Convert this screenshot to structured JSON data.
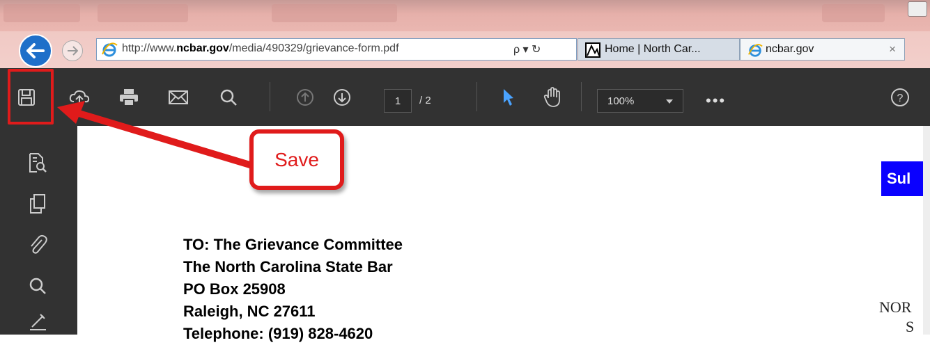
{
  "browser": {
    "url_prefix": "http://www.",
    "url_domain": "ncbar.gov",
    "url_path": "/media/490329/grievance-form.pdf",
    "search_symbol": "ρ ▾ ↻",
    "tabs": [
      {
        "label": "Home | North Car...",
        "icon": "north-carolina-logo-icon",
        "active": false
      },
      {
        "label": "ncbar.gov",
        "icon": "ie-icon",
        "active": true,
        "close": "×"
      }
    ]
  },
  "pdf_toolbar": {
    "current_page": "1",
    "total_pages": "/ 2",
    "zoom": "100%",
    "more": "•••",
    "help": "?"
  },
  "document": {
    "lines": [
      "TO: The Grievance Committee",
      "The North Carolina State Bar",
      "PO Box 25908",
      "Raleigh, NC 27611",
      "Telephone: (919) 828-4620"
    ],
    "sub_box_text": "Sul",
    "nor_line_1": "NOR",
    "nor_line_2": "S"
  },
  "annotation": {
    "callout_text": "Save",
    "color": "#e01b1b"
  }
}
